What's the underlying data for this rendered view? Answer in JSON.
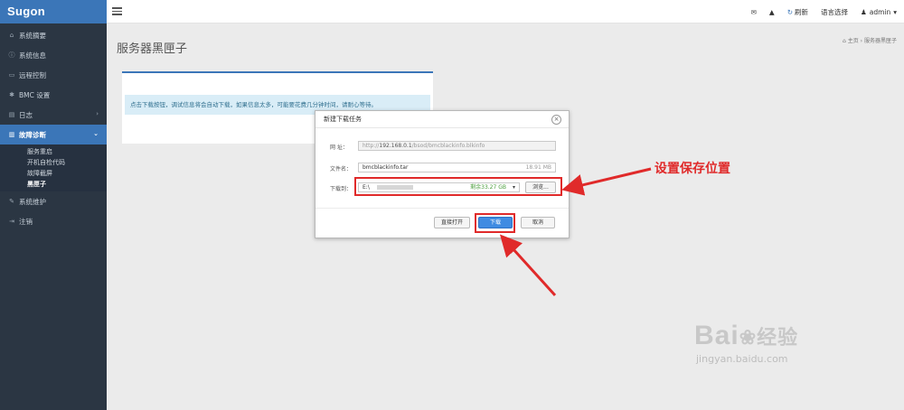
{
  "sidebar": {
    "logo": "Sugon",
    "items": [
      {
        "icon": "home-icon",
        "glyph": "⌂",
        "label": "系统摘要"
      },
      {
        "icon": "info-icon",
        "glyph": "ⓘ",
        "label": "系统信息"
      },
      {
        "icon": "monitor-icon",
        "glyph": "▭",
        "label": "远程控制"
      },
      {
        "icon": "gear-icon",
        "glyph": "✱",
        "label": "BMC 设置"
      },
      {
        "icon": "log-icon",
        "glyph": "▤",
        "label": "日志"
      },
      {
        "icon": "chart-icon",
        "glyph": "▥",
        "label": "故障诊断"
      },
      {
        "icon": "wrench-icon",
        "glyph": "✎",
        "label": "系统维护"
      },
      {
        "icon": "logout-icon",
        "glyph": "⇥",
        "label": "注销"
      }
    ],
    "submenu": [
      "服务重启",
      "开机自检代码",
      "故障截屏",
      "黑匣子"
    ]
  },
  "topbar": {
    "refresh": "刷新",
    "language": "语言选择",
    "user": "admin"
  },
  "page": {
    "title": "服务器黑匣子",
    "breadcrumb_home": "主页",
    "breadcrumb_current": "服务器黑匣子",
    "info": "点击下载按钮，调试信息将会自动下载，如果信息太多，可能要花费几分钟时间，请耐心等待。"
  },
  "dialog": {
    "title": "新建下载任务",
    "url_label": "网    址：",
    "url_prefix": "http://",
    "url_host": "192.168.0.1",
    "url_path": "/bsod/bmcblackinfo.blkinfo",
    "filename_label": "文件名：",
    "filename": "bmcblackinfo.tar",
    "filesize": "18.91 MB",
    "saveto_label": "下载到：",
    "saveto_path": "E:\\",
    "free_space": "剩余33.27 GB",
    "browse": "浏览...",
    "open_direct": "直接打开",
    "download": "下载",
    "cancel": "取消"
  },
  "annotation": {
    "text": "设置保存位置",
    "color": "#e02a2a"
  },
  "watermark": {
    "brand": "Bai",
    "brand_tail": "经验",
    "url": "jingyan.baidu.com"
  }
}
